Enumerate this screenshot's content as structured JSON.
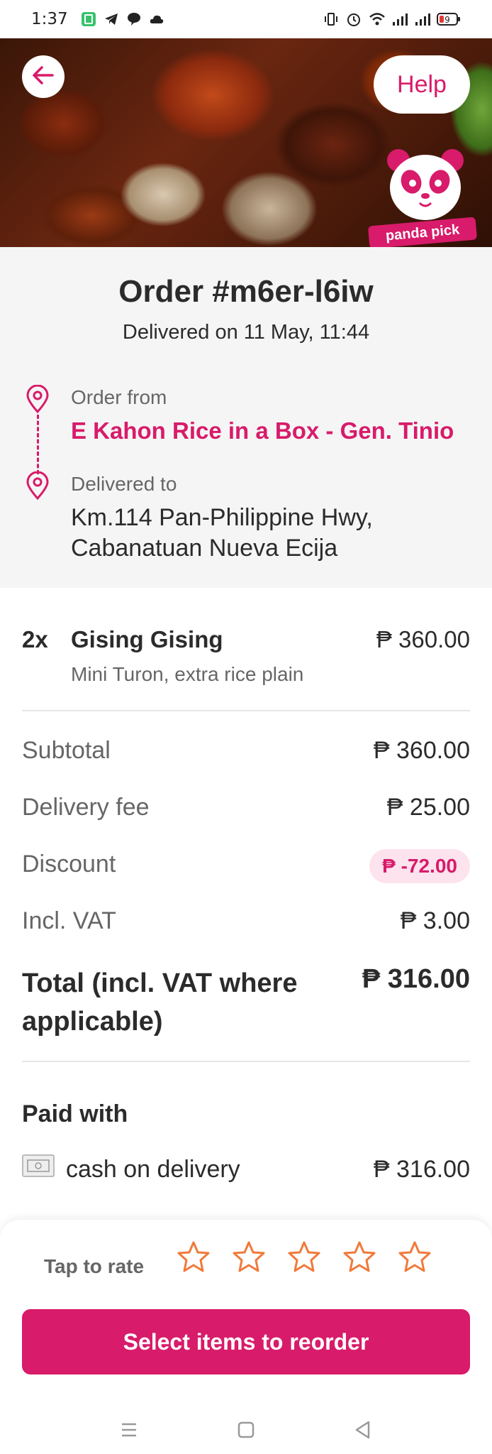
{
  "status_bar": {
    "time": "1:37",
    "left_icons": [
      "app-icon",
      "telegram-icon",
      "chat-icon",
      "cloud-icon"
    ],
    "right_icons": [
      "vibrate-icon",
      "alarm-icon",
      "wifi-icon",
      "signal-icon",
      "signal-icon",
      "battery-icon"
    ],
    "battery": "9"
  },
  "hero": {
    "help_label": "Help",
    "badge_label": "panda pick"
  },
  "order": {
    "title": "Order #m6er-l6iw",
    "delivered_date": "Delivered on 11 May, 11:44",
    "from_label": "Order from",
    "from_name": "E Kahon Rice in a Box - Gen. Tinio",
    "to_label": "Delivered to",
    "to_address": "Km.114 Pan-Philippine Hwy, Cabanatuan Nueva Ecija"
  },
  "items": [
    {
      "qty": "2x",
      "name": "Gising Gising",
      "price": "₱ 360.00",
      "description": "Mini Turon, extra rice plain"
    }
  ],
  "summary": {
    "subtotal_label": "Subtotal",
    "subtotal_value": "₱ 360.00",
    "delivery_label": "Delivery fee",
    "delivery_value": "₱ 25.00",
    "discount_label": "Discount",
    "discount_value": "₱ -72.00",
    "vat_label": "Incl. VAT",
    "vat_value": "₱ 3.00",
    "total_label": "Total (incl. VAT where applicable)",
    "total_value": "₱ 316.00"
  },
  "payment": {
    "heading": "Paid with",
    "method": "cash on delivery",
    "amount": "₱ 316.00"
  },
  "rating": {
    "label": "Tap to rate",
    "stars": 5
  },
  "cta": {
    "reorder_label": "Select items to reorder"
  },
  "colors": {
    "brand": "#d81b6a",
    "star": "#f07a3a",
    "discount_bg": "#fde3ee"
  }
}
